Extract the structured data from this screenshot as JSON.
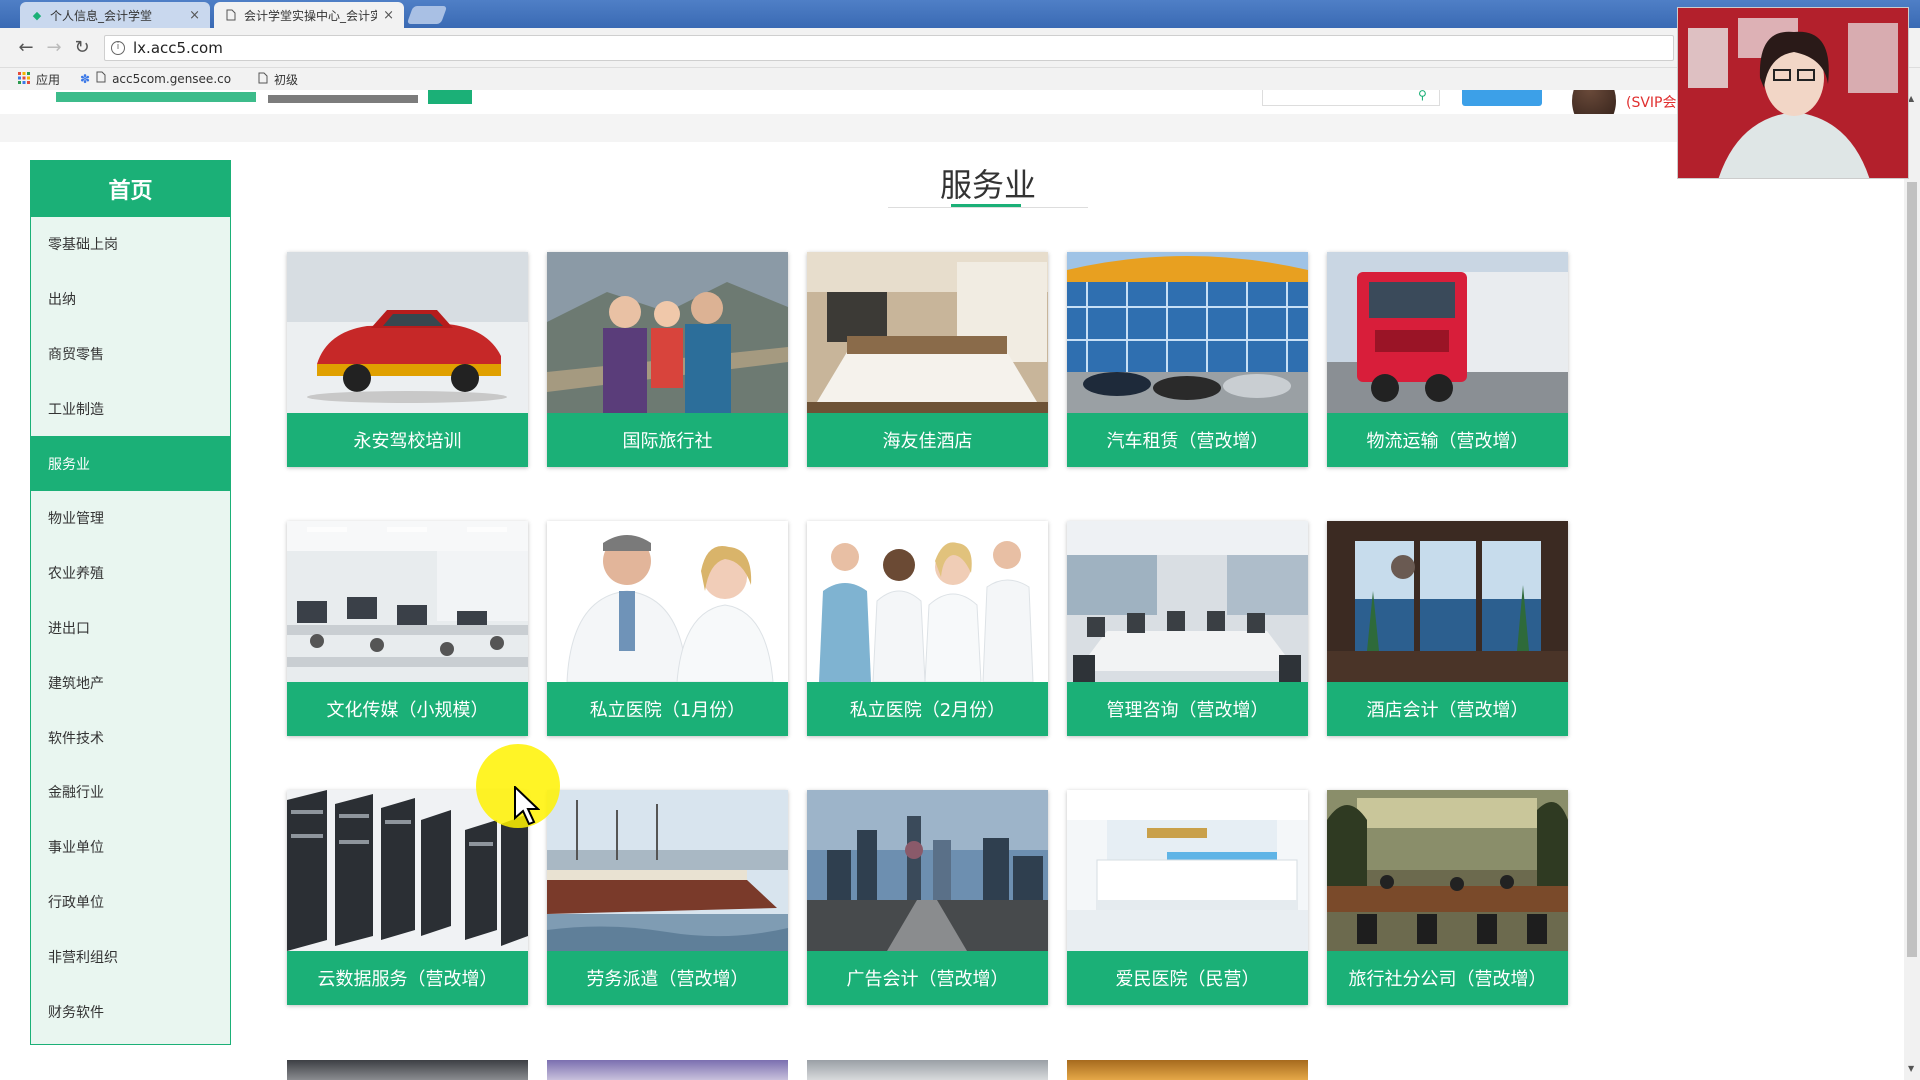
{
  "browser": {
    "tabs": [
      {
        "title": "个人信息_会计学堂",
        "close": "×"
      },
      {
        "title": "会计学堂实操中心_会计实",
        "close": "×"
      }
    ],
    "nav": {
      "back": "←",
      "forward": "→",
      "reload": "↻"
    },
    "url": "lx.acc5.com",
    "bookmarks": [
      {
        "label": "应用"
      },
      {
        "label": "acc5com.gensee.co"
      },
      {
        "label": "初级"
      }
    ]
  },
  "header": {
    "svip_text": "(SVIP会"
  },
  "sidebar": {
    "home": "首页",
    "items": [
      {
        "label": "零基础上岗"
      },
      {
        "label": "出纳"
      },
      {
        "label": "商贸零售"
      },
      {
        "label": "工业制造"
      },
      {
        "label": "服务业",
        "active": true
      },
      {
        "label": "物业管理"
      },
      {
        "label": "农业养殖"
      },
      {
        "label": "进出口"
      },
      {
        "label": "建筑地产"
      },
      {
        "label": "软件技术"
      },
      {
        "label": "金融行业"
      },
      {
        "label": "事业单位"
      },
      {
        "label": "行政单位"
      },
      {
        "label": "非营利组织"
      },
      {
        "label": "财务软件"
      }
    ]
  },
  "main": {
    "section_title": "服务业",
    "cards": [
      {
        "label": "永安驾校培训",
        "picture": "taxi-car"
      },
      {
        "label": "国际旅行社",
        "picture": "family-great-wall"
      },
      {
        "label": "海友佳酒店",
        "picture": "hotel-room"
      },
      {
        "label": "汽车租赁（营改增）",
        "picture": "car-dealership"
      },
      {
        "label": "物流运输（营改增）",
        "picture": "red-truck"
      },
      {
        "label": "文化传媒（小规模）",
        "picture": "open-office"
      },
      {
        "label": "私立医院（1月份）",
        "picture": "two-doctors"
      },
      {
        "label": "私立医院（2月份）",
        "picture": "medical-team"
      },
      {
        "label": "管理咨询（营改增）",
        "picture": "meeting-room"
      },
      {
        "label": "酒店会计（营改增）",
        "picture": "sea-view-lobby"
      },
      {
        "label": "云数据服务（营改增）",
        "picture": "server-racks"
      },
      {
        "label": "劳务派遣（营改增）",
        "picture": "cargo-ship"
      },
      {
        "label": "广告会计（营改增）",
        "picture": "city-skyline"
      },
      {
        "label": "爱民医院（民营）",
        "picture": "hospital-reception"
      },
      {
        "label": "旅行社分公司（营改增）",
        "picture": "travel-office"
      }
    ]
  },
  "colors": {
    "accent": "#1bb077",
    "sidebar_bg": "#e9f6f0",
    "svip": "#e03030"
  }
}
